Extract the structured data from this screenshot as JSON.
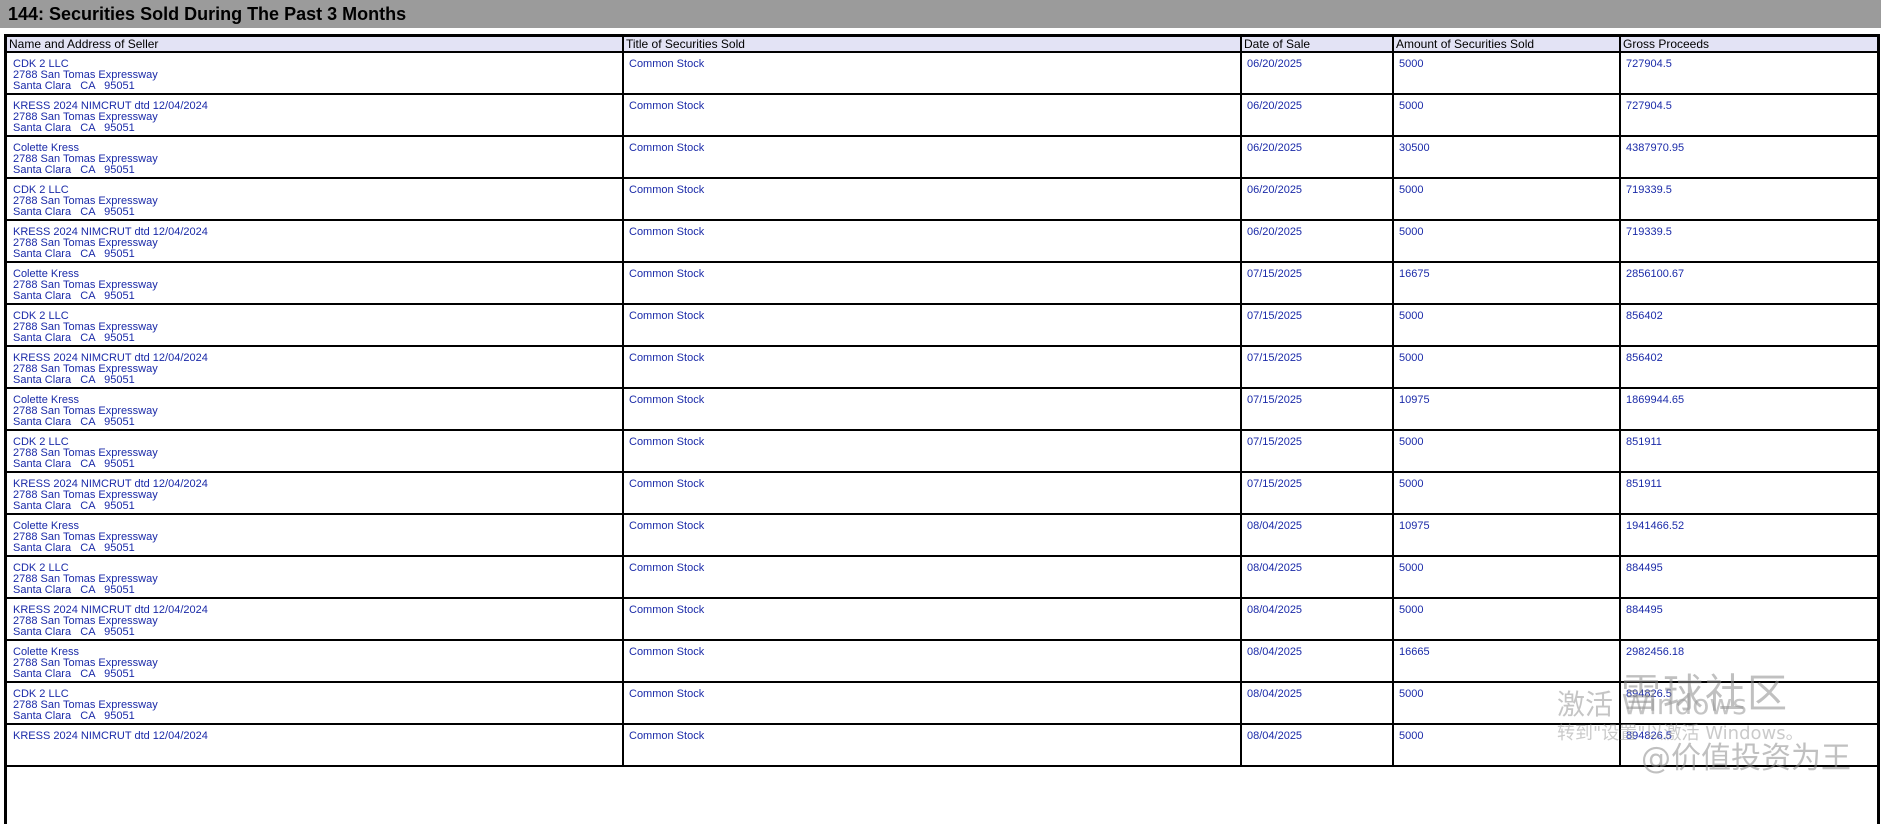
{
  "section": {
    "title": "144: Securities Sold During The Past 3 Months"
  },
  "table": {
    "columns": [
      "Name and Address of Seller",
      "Title of Securities Sold",
      "Date of Sale",
      "Amount of Securities Sold",
      "Gross Proceeds"
    ],
    "rows": [
      {
        "name": "CDK 2 LLC",
        "street": "2788 San Tomas Expressway",
        "city": "Santa Clara   CA   95051",
        "title": "Common Stock",
        "date": "06/20/2025",
        "amount": "5000",
        "proceeds": "727904.5"
      },
      {
        "name": "KRESS 2024 NIMCRUT dtd 12/04/2024",
        "street": "2788 San Tomas Expressway",
        "city": "Santa Clara   CA   95051",
        "title": "Common Stock",
        "date": "06/20/2025",
        "amount": "5000",
        "proceeds": "727904.5"
      },
      {
        "name": "Colette Kress",
        "street": "2788 San Tomas Expressway",
        "city": "Santa Clara   CA   95051",
        "title": "Common Stock",
        "date": "06/20/2025",
        "amount": "30500",
        "proceeds": "4387970.95"
      },
      {
        "name": "CDK 2 LLC",
        "street": "2788 San Tomas Expressway",
        "city": "Santa Clara   CA   95051",
        "title": "Common Stock",
        "date": "06/20/2025",
        "amount": "5000",
        "proceeds": "719339.5"
      },
      {
        "name": "KRESS 2024 NIMCRUT dtd 12/04/2024",
        "street": "2788 San Tomas Expressway",
        "city": "Santa Clara   CA   95051",
        "title": "Common Stock",
        "date": "06/20/2025",
        "amount": "5000",
        "proceeds": "719339.5"
      },
      {
        "name": "Colette Kress",
        "street": "2788 San Tomas Expressway",
        "city": "Santa Clara   CA   95051",
        "title": "Common Stock",
        "date": "07/15/2025",
        "amount": "16675",
        "proceeds": "2856100.67"
      },
      {
        "name": "CDK 2 LLC",
        "street": "2788 San Tomas Expressway",
        "city": "Santa Clara   CA   95051",
        "title": "Common Stock",
        "date": "07/15/2025",
        "amount": "5000",
        "proceeds": "856402"
      },
      {
        "name": "KRESS 2024 NIMCRUT dtd 12/04/2024",
        "street": "2788 San Tomas Expressway",
        "city": "Santa Clara   CA   95051",
        "title": "Common Stock",
        "date": "07/15/2025",
        "amount": "5000",
        "proceeds": "856402"
      },
      {
        "name": "Colette Kress",
        "street": "2788 San Tomas Expressway",
        "city": "Santa Clara   CA   95051",
        "title": "Common Stock",
        "date": "07/15/2025",
        "amount": "10975",
        "proceeds": "1869944.65"
      },
      {
        "name": "CDK 2 LLC",
        "street": "2788 San Tomas Expressway",
        "city": "Santa Clara   CA   95051",
        "title": "Common Stock",
        "date": "07/15/2025",
        "amount": "5000",
        "proceeds": "851911"
      },
      {
        "name": "KRESS 2024 NIMCRUT dtd 12/04/2024",
        "street": "2788 San Tomas Expressway",
        "city": "Santa Clara   CA   95051",
        "title": "Common Stock",
        "date": "07/15/2025",
        "amount": "5000",
        "proceeds": "851911"
      },
      {
        "name": "Colette Kress",
        "street": "2788 San Tomas Expressway",
        "city": "Santa Clara   CA   95051",
        "title": "Common Stock",
        "date": "08/04/2025",
        "amount": "10975",
        "proceeds": "1941466.52"
      },
      {
        "name": "CDK 2 LLC",
        "street": "2788 San Tomas Expressway",
        "city": "Santa Clara   CA   95051",
        "title": "Common Stock",
        "date": "08/04/2025",
        "amount": "5000",
        "proceeds": "884495"
      },
      {
        "name": "KRESS 2024 NIMCRUT dtd 12/04/2024",
        "street": "2788 San Tomas Expressway",
        "city": "Santa Clara   CA   95051",
        "title": "Common Stock",
        "date": "08/04/2025",
        "amount": "5000",
        "proceeds": "884495"
      },
      {
        "name": "Colette Kress",
        "street": "2788 San Tomas Expressway",
        "city": "Santa Clara   CA   95051",
        "title": "Common Stock",
        "date": "08/04/2025",
        "amount": "16665",
        "proceeds": "2982456.18"
      },
      {
        "name": "CDK 2 LLC",
        "street": "2788 San Tomas Expressway",
        "city": "Santa Clara   CA   95051",
        "title": "Common Stock",
        "date": "08/04/2025",
        "amount": "5000",
        "proceeds": "894826.5"
      },
      {
        "name": "KRESS 2024 NIMCRUT dtd 12/04/2024",
        "street": "",
        "city": "",
        "title": "Common Stock",
        "date": "08/04/2025",
        "amount": "5000",
        "proceeds": "894826.5"
      }
    ]
  },
  "watermark": {
    "logo_text": "雪球社区",
    "activate_text": "激活 Windows",
    "activate_subtext": "转到\"设置\"以激活 Windows。",
    "handle_text": "@价值投资为王"
  },
  "colors": {
    "header_bar": "#9b9b9b",
    "column_header_bg": "#e3e3f5",
    "cell_text": "#1a2aa8",
    "border": "#000000"
  }
}
